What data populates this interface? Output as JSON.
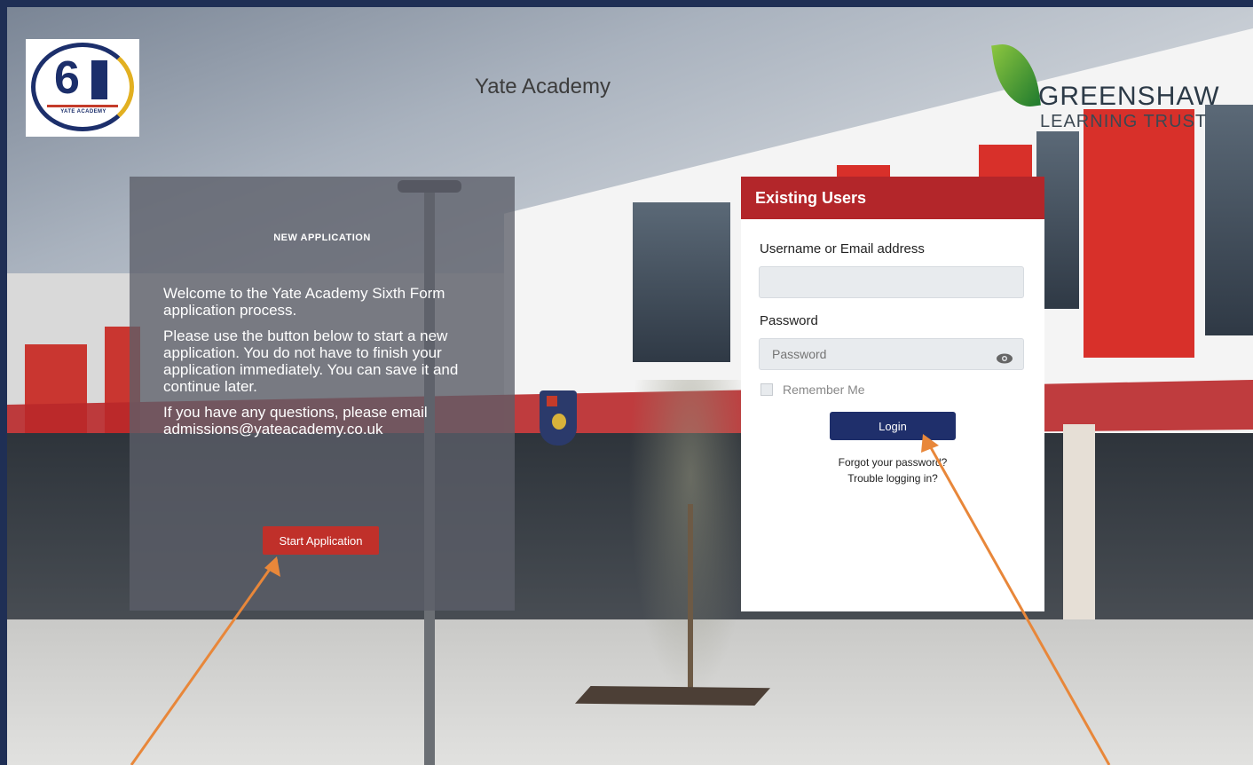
{
  "header": {
    "site_title": "Yate Academy",
    "logo_left_text": "YATE ACADEMY",
    "logo_left_number": "6",
    "logo_right_name": "GREENSHAW",
    "logo_right_subtitle": "LEARNING TRUST"
  },
  "new_application": {
    "heading": "NEW APPLICATION",
    "paragraphs": [
      "Welcome to the Yate Academy Sixth Form application process.",
      "Please use the button below to start a new application. You do not have to finish your application immediately. You can save it and continue later.",
      "If you have any questions, please email admissions@yateacademy.co.uk"
    ],
    "start_button_label": "Start Application"
  },
  "existing_users": {
    "heading": "Existing Users",
    "username_label": "Username or Email address",
    "username_value": "",
    "password_label": "Password",
    "password_placeholder": "Password",
    "remember_label": "Remember Me",
    "login_button_label": "Login",
    "forgot_link": "Forgot your password?",
    "trouble_link": "Trouble logging in?"
  },
  "colors": {
    "frame": "#1f2f55",
    "accent_red": "#b3262a",
    "login_blue": "#1f2f6b",
    "annotation_arrow": "#e8873a"
  },
  "icons": [
    "show-password-eye-icon"
  ]
}
